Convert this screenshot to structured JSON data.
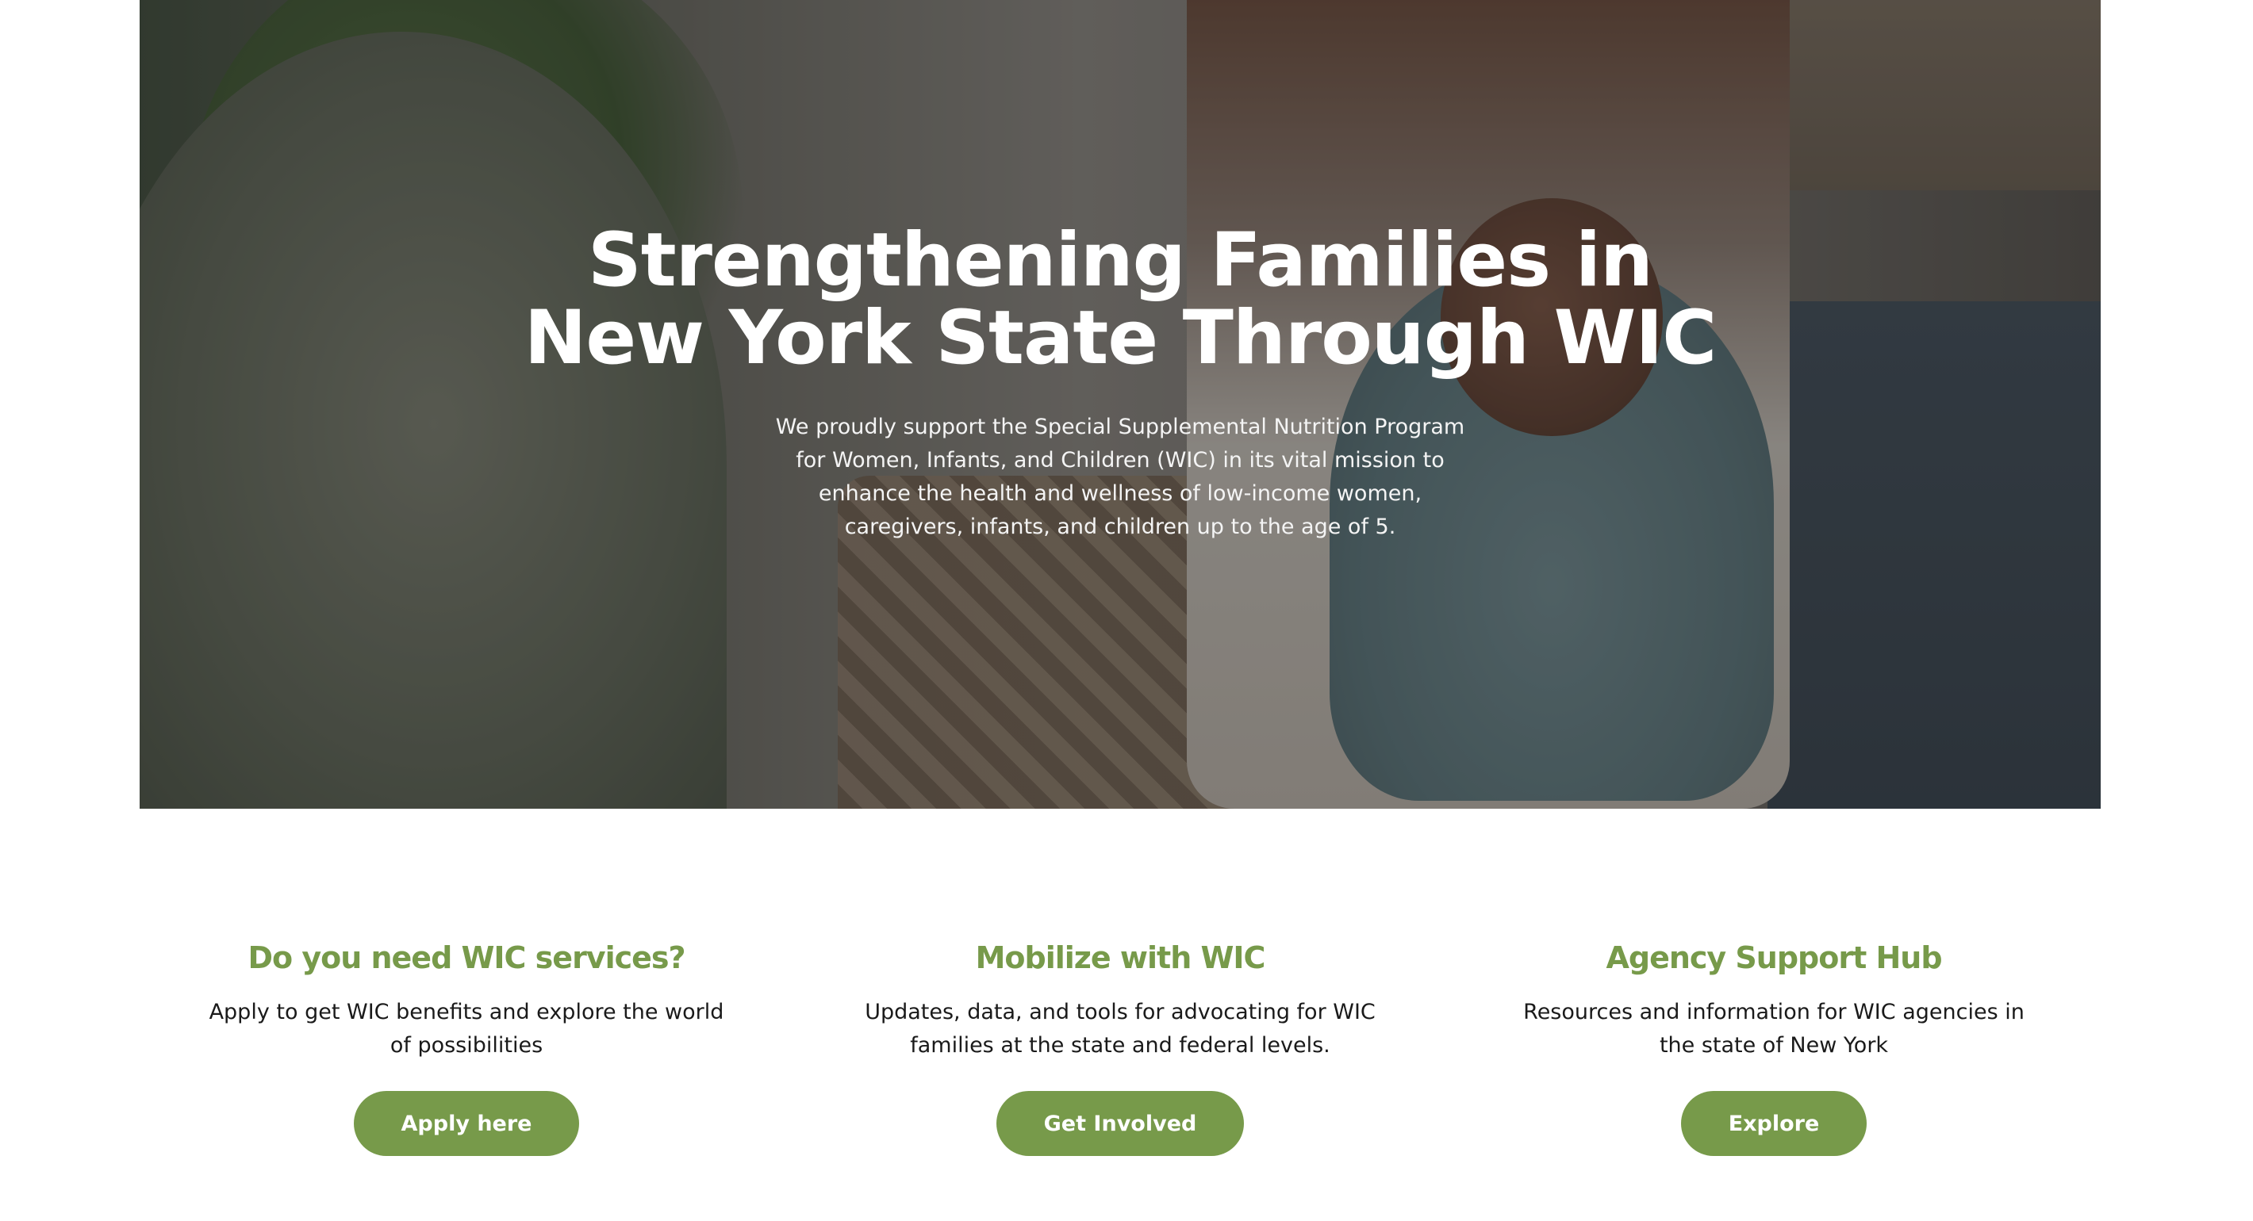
{
  "hero": {
    "title": "Strengthening Families in New York State Through WIC",
    "text": "We proudly support the Special Supplemental Nutrition Program for Women, Infants, and Children (WIC) in its vital mission to enhance the health and wellness of low-income women, caregivers, infants, and children up to the age of 5."
  },
  "cards": [
    {
      "title": "Do you need WIC services?",
      "text": "Apply to get WIC benefits and explore the world of possibilities",
      "button": "Apply here"
    },
    {
      "title": "Mobilize with WIC",
      "text": "Updates, data, and tools for advocating for WIC families at the state and federal levels.",
      "button": "Get Involved"
    },
    {
      "title": "Agency Support Hub",
      "text": "Resources and information for WIC agencies in the state of New York",
      "button": "Explore"
    }
  ],
  "colors": {
    "accent": "#779a4a",
    "text": "#1a1a1a",
    "hero_text": "#ffffff"
  }
}
